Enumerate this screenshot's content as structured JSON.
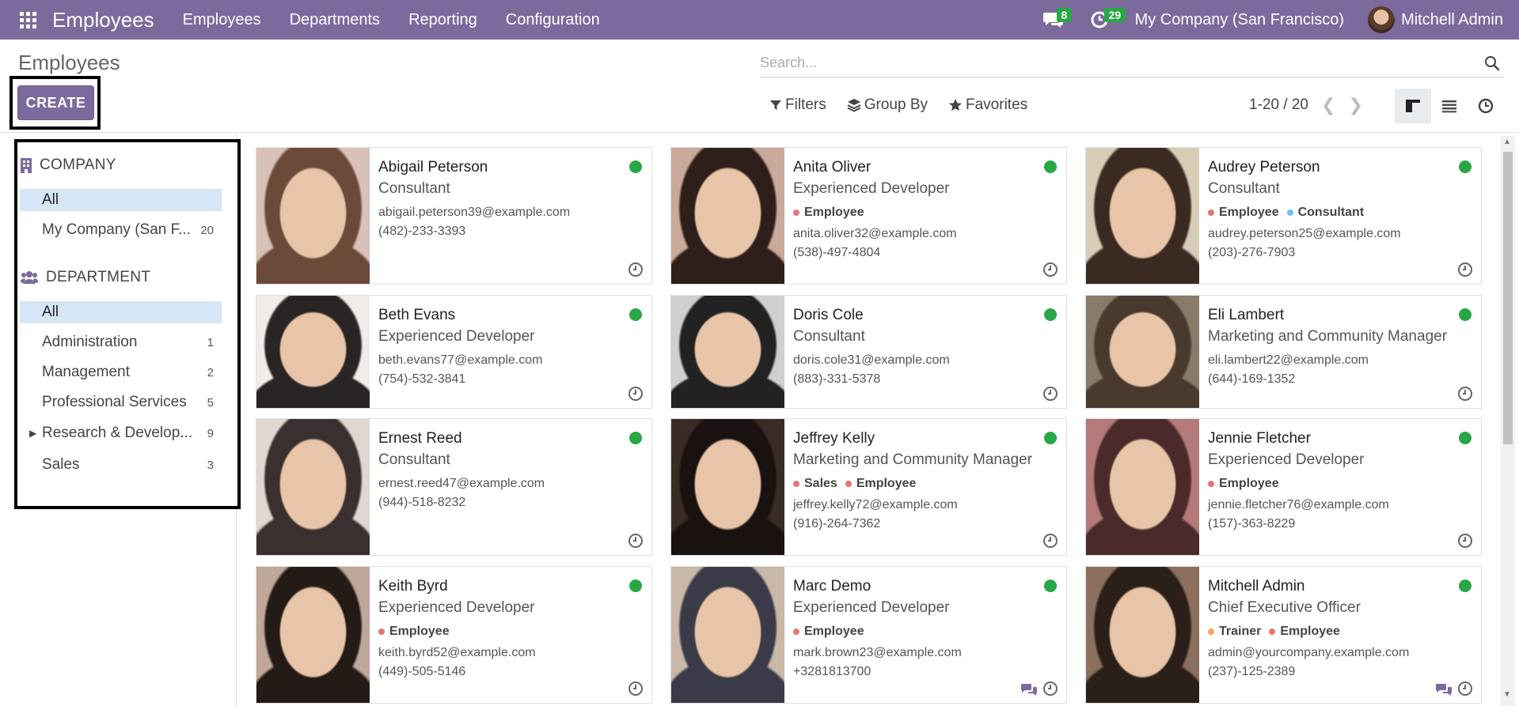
{
  "navbar": {
    "brand": "Employees",
    "menu": [
      "Employees",
      "Departments",
      "Reporting",
      "Configuration"
    ],
    "messages_count": "8",
    "activities_count": "29",
    "company": "My Company (San Francisco)",
    "user": "Mitchell Admin",
    "accent_color": "#7c6a9d"
  },
  "control_panel": {
    "title": "Employees",
    "create_label": "CREATE",
    "search_placeholder": "Search...",
    "filters_label": "Filters",
    "groupby_label": "Group By",
    "favorites_label": "Favorites",
    "pager": "1-20 / 20",
    "views": [
      "kanban-icon",
      "list-icon",
      "activity-icon"
    ]
  },
  "side_panel": {
    "company_title": "COMPANY",
    "company_items": [
      {
        "label": "All",
        "count": ""
      },
      {
        "label": "My Company (San F...",
        "count": "20"
      }
    ],
    "department_title": "DEPARTMENT",
    "department_items": [
      {
        "label": "All",
        "count": ""
      },
      {
        "label": "Administration",
        "count": "1"
      },
      {
        "label": "Management",
        "count": "2"
      },
      {
        "label": "Professional Services",
        "count": "5"
      },
      {
        "label": "Research & Develop...",
        "count": "9"
      },
      {
        "label": "Sales",
        "count": "3"
      }
    ]
  },
  "employees": [
    {
      "name": "Abigail Peterson",
      "job": "Consultant",
      "tags": [],
      "email": "abigail.peterson39@example.com",
      "phone": "(482)-233-3393",
      "chatter": false
    },
    {
      "name": "Anita Oliver",
      "job": "Experienced Developer",
      "tags": [
        {
          "label": "Employee",
          "color": "#e77474"
        }
      ],
      "email": "anita.oliver32@example.com",
      "phone": "(538)-497-4804",
      "chatter": false
    },
    {
      "name": "Audrey Peterson",
      "job": "Consultant",
      "tags": [
        {
          "label": "Employee",
          "color": "#e77474"
        },
        {
          "label": "Consultant",
          "color": "#6cc1ed"
        }
      ],
      "email": "audrey.peterson25@example.com",
      "phone": "(203)-276-7903",
      "chatter": false
    },
    {
      "name": "Beth Evans",
      "job": "Experienced Developer",
      "tags": [],
      "email": "beth.evans77@example.com",
      "phone": "(754)-532-3841",
      "chatter": false
    },
    {
      "name": "Doris Cole",
      "job": "Consultant",
      "tags": [],
      "email": "doris.cole31@example.com",
      "phone": "(883)-331-5378",
      "chatter": false
    },
    {
      "name": "Eli Lambert",
      "job": "Marketing and Community Manager",
      "tags": [],
      "email": "eli.lambert22@example.com",
      "phone": "(644)-169-1352",
      "chatter": false
    },
    {
      "name": "Ernest Reed",
      "job": "Consultant",
      "tags": [],
      "email": "ernest.reed47@example.com",
      "phone": "(944)-518-8232",
      "chatter": false
    },
    {
      "name": "Jeffrey Kelly",
      "job": "Marketing and Community Manager",
      "tags": [
        {
          "label": "Sales",
          "color": "#e77474"
        },
        {
          "label": "Employee",
          "color": "#e77474"
        }
      ],
      "email": "jeffrey.kelly72@example.com",
      "phone": "(916)-264-7362",
      "chatter": false
    },
    {
      "name": "Jennie Fletcher",
      "job": "Experienced Developer",
      "tags": [
        {
          "label": "Employee",
          "color": "#e77474"
        }
      ],
      "email": "jennie.fletcher76@example.com",
      "phone": "(157)-363-8229",
      "chatter": false
    },
    {
      "name": "Keith Byrd",
      "job": "Experienced Developer",
      "tags": [
        {
          "label": "Employee",
          "color": "#e77474"
        }
      ],
      "email": "keith.byrd52@example.com",
      "phone": "(449)-505-5146",
      "chatter": false
    },
    {
      "name": "Marc Demo",
      "job": "Experienced Developer",
      "tags": [
        {
          "label": "Employee",
          "color": "#e77474"
        }
      ],
      "email": "mark.brown23@example.com",
      "phone": "+3281813700",
      "chatter": true
    },
    {
      "name": "Mitchell Admin",
      "job": "Chief Executive Officer",
      "tags": [
        {
          "label": "Trainer",
          "color": "#f4a460"
        },
        {
          "label": "Employee",
          "color": "#e77474"
        }
      ],
      "email": "admin@yourcompany.example.com",
      "phone": "(237)-125-2389",
      "chatter": true
    }
  ]
}
